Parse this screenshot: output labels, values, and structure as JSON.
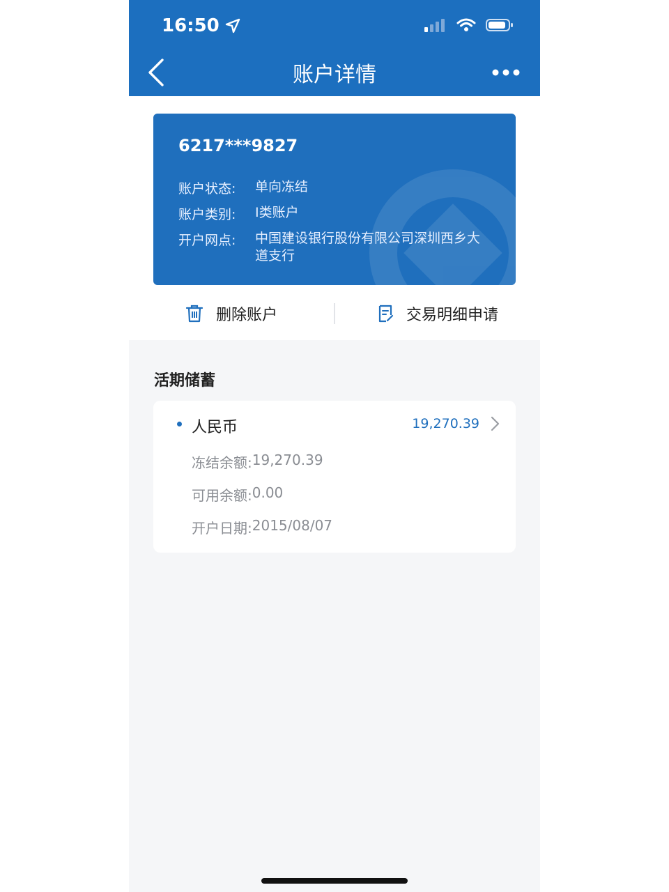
{
  "status_bar": {
    "time": "16:50"
  },
  "nav": {
    "title": "账户详情"
  },
  "card": {
    "number": "6217***9827",
    "rows": [
      {
        "label": "账户状态:",
        "value": "单向冻结"
      },
      {
        "label": "账户类别:",
        "value": "I类账户"
      },
      {
        "label": "开户网点:",
        "value": "中国建设银行股份有限公司深圳西乡大道支行"
      }
    ]
  },
  "actions": [
    {
      "label": "删除账户",
      "icon": "trash-icon"
    },
    {
      "label": "交易明细申请",
      "icon": "document-icon"
    }
  ],
  "section": {
    "title": "活期储蓄"
  },
  "account": {
    "currency": "人民币",
    "balance": "19,270.39",
    "details": [
      {
        "label": "冻结余额:",
        "value": "19,270.39"
      },
      {
        "label": "可用余额:",
        "value": "0.00"
      },
      {
        "label": "开户日期:",
        "value": "2015/08/07"
      }
    ]
  },
  "colors": {
    "brand_blue": "#1c6fbf",
    "background": "#f5f6f8"
  }
}
